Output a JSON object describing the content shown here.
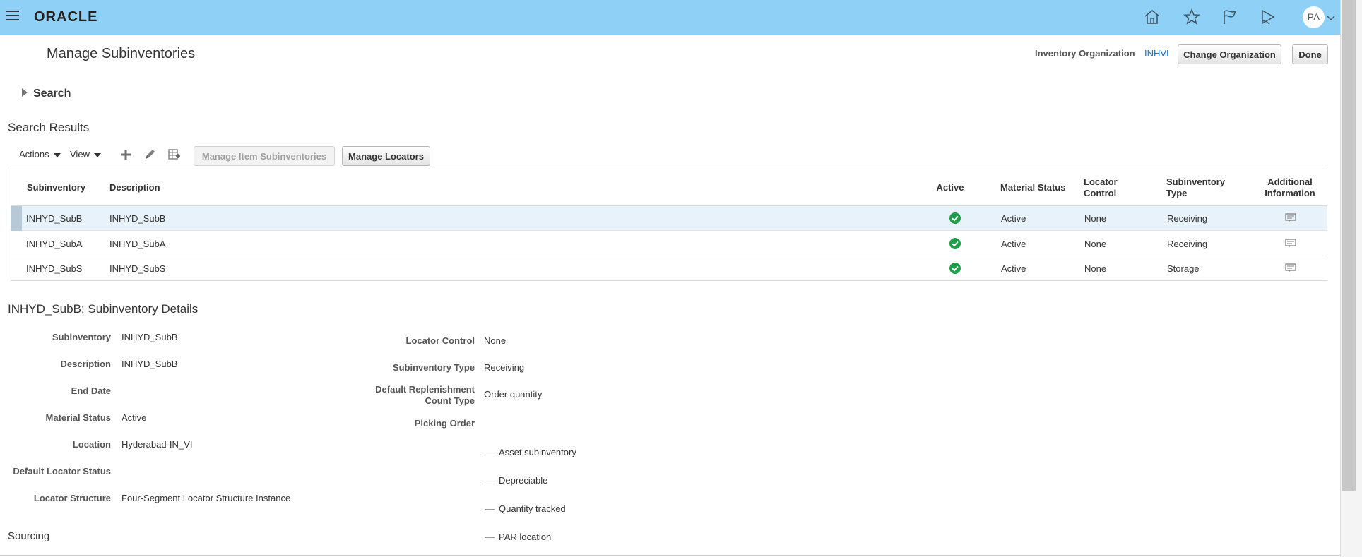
{
  "header": {
    "brand": "ORACLE",
    "user_initials": "PA",
    "icons": [
      "home-icon",
      "star-icon",
      "flag-icon",
      "notifications-icon"
    ]
  },
  "page": {
    "title": "Manage Subinventories",
    "inventory_org_label": "Inventory Organization",
    "inventory_org_value": "INHVI",
    "change_org_label": "Change Organization",
    "done_label": "Done"
  },
  "search": {
    "label": "Search"
  },
  "results": {
    "title": "Search Results",
    "actions_label": "Actions",
    "view_label": "View",
    "manage_item_subinventories_label": "Manage Item Subinventories",
    "manage_locators_label": "Manage Locators",
    "columns": {
      "subinventory": "Subinventory",
      "description": "Description",
      "active": "Active",
      "material_status": "Material Status",
      "locator_control": "Locator Control",
      "subinventory_type": "Subinventory Type",
      "additional_information": "Additional Information"
    },
    "rows": [
      {
        "subinventory": "INHYD_SubB",
        "description": "INHYD_SubB",
        "material_status": "Active",
        "locator_control": "None",
        "subinventory_type": "Receiving"
      },
      {
        "subinventory": "INHYD_SubA",
        "description": "INHYD_SubA",
        "material_status": "Active",
        "locator_control": "None",
        "subinventory_type": "Receiving"
      },
      {
        "subinventory": "INHYD_SubS",
        "description": "INHYD_SubS",
        "material_status": "Active",
        "locator_control": "None",
        "subinventory_type": "Storage"
      }
    ]
  },
  "details": {
    "title": "INHYD_SubB: Subinventory Details",
    "subinventory_label": "Subinventory",
    "subinventory_value": "INHYD_SubB",
    "description_label": "Description",
    "description_value": "INHYD_SubB",
    "end_date_label": "End Date",
    "material_status_label": "Material Status",
    "material_status_value": "Active",
    "location_label": "Location",
    "location_value": "Hyderabad-IN_VI",
    "default_locator_status_label": "Default Locator Status",
    "locator_structure_label": "Locator Structure",
    "locator_structure_value": "Four-Segment Locator Structure Instance",
    "locator_control_label": "Locator Control",
    "locator_control_value": "None",
    "subinventory_type_label": "Subinventory Type",
    "subinventory_type_value": "Receiving",
    "default_replenishment_label_1": "Default Replenishment",
    "default_replenishment_label_2": "Count Type",
    "default_replenishment_value": "Order quantity",
    "picking_order_label": "Picking Order",
    "checkboxes": [
      "Asset subinventory",
      "Depreciable",
      "Quantity tracked",
      "PAR location"
    ]
  },
  "sourcing": {
    "title": "Sourcing"
  },
  "colors": {
    "header_bg": "#8fd0f7",
    "link": "#0572ce",
    "active_check": "#1e9e4a",
    "selected_row": "#e7f2fb"
  }
}
